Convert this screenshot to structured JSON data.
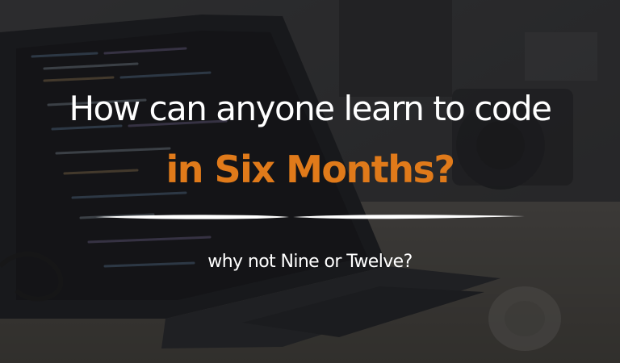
{
  "hero": {
    "title_line1": "How can anyone learn to code",
    "title_line2": "in Six Months?",
    "subtitle": "why not Nine or Twelve?"
  },
  "colors": {
    "accent": "#e07a1a",
    "text": "#ffffff"
  }
}
